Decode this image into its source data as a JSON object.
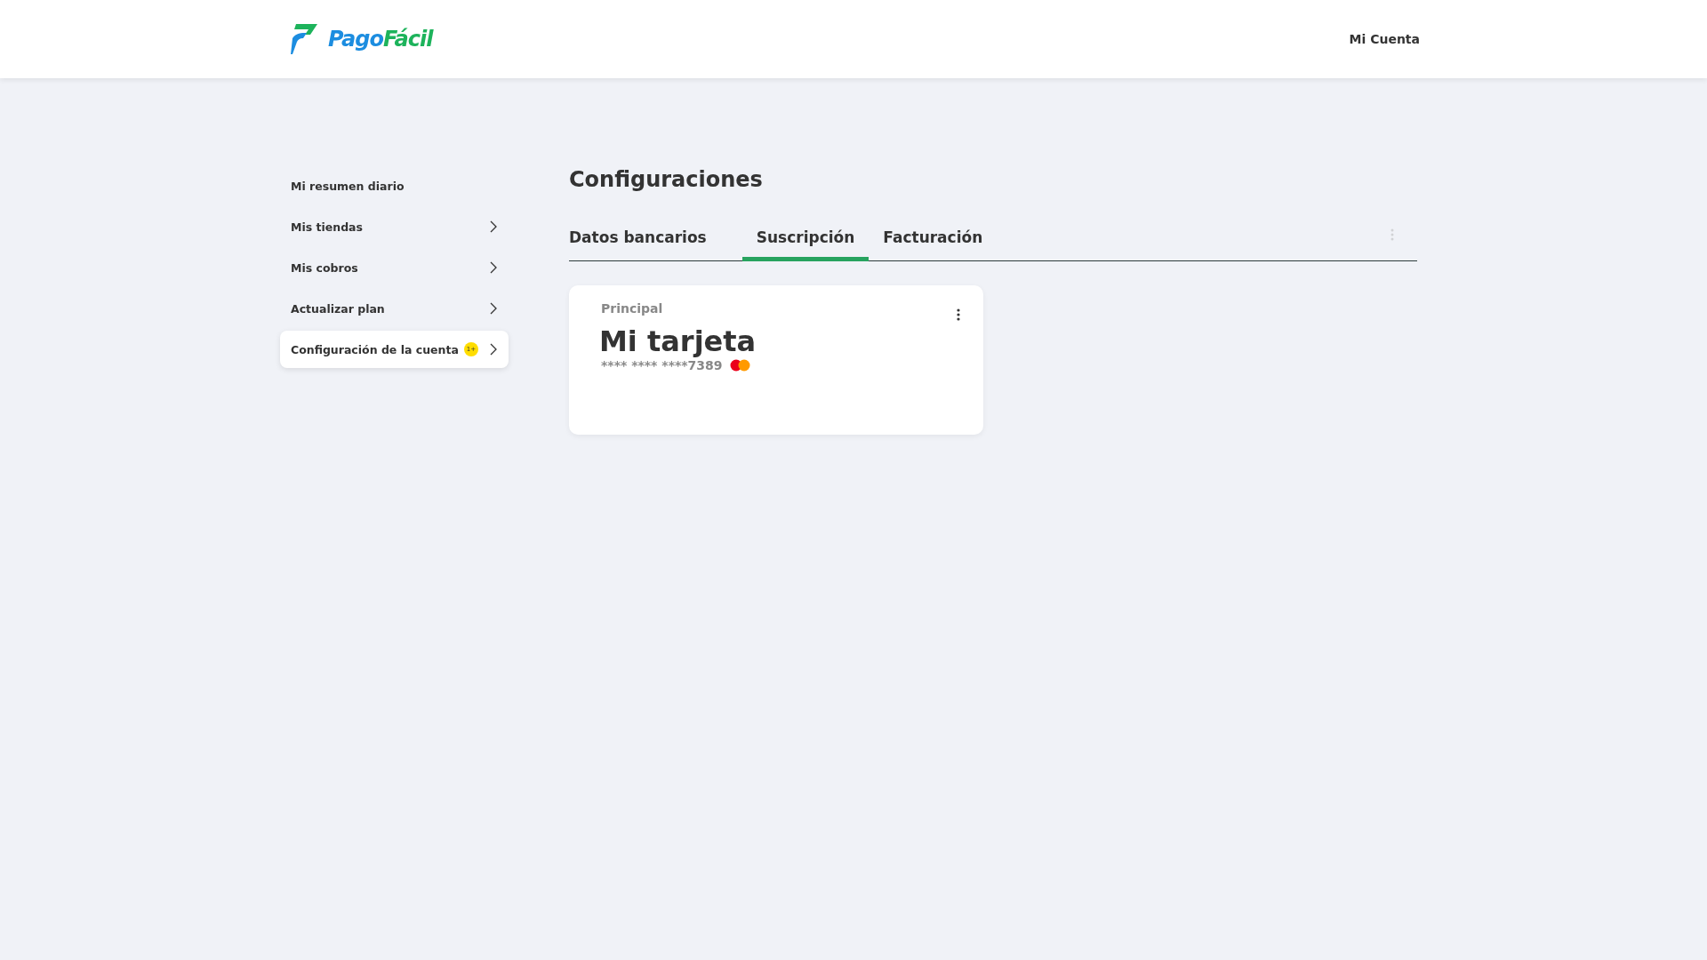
{
  "header": {
    "logo": {
      "first": "Pago",
      "second": "Fácil"
    },
    "account_link": "Mi Cuenta"
  },
  "sidebar": {
    "items": [
      {
        "label": "Mi resumen diario",
        "kind": "link",
        "selected": false
      },
      {
        "label": "Mis tiendas",
        "kind": "expandable",
        "selected": false
      },
      {
        "label": "Mis cobros",
        "kind": "expandable",
        "selected": false
      },
      {
        "label": "Actualizar plan",
        "kind": "expandable",
        "selected": false
      },
      {
        "label": "Configuración de la cuenta",
        "kind": "expandable",
        "selected": true,
        "badge": "1+"
      }
    ]
  },
  "main": {
    "title": "Configuraciones",
    "tabs": [
      {
        "label": "Datos bancarios",
        "selected": false
      },
      {
        "label": "Suscripción",
        "selected": true
      },
      {
        "label": "Facturación",
        "selected": false
      }
    ],
    "card": {
      "tag": "Principal",
      "name": "Mi tarjeta",
      "number": "**** **** ****7389"
    }
  }
}
